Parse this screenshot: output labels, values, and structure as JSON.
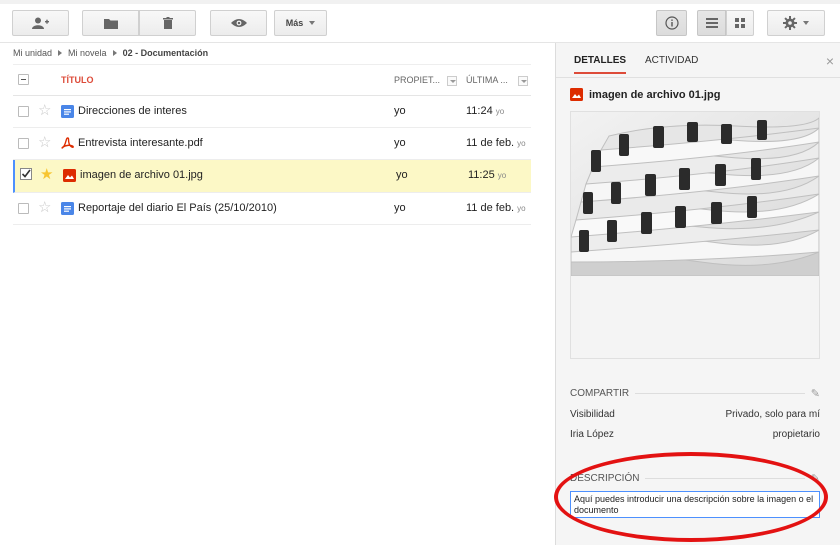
{
  "toolbar": {
    "more_label": "Más"
  },
  "breadcrumb": [
    "Mi unidad",
    "Mi novela",
    "02 - Documentación"
  ],
  "columns": {
    "title": "TÍTULO",
    "owner": "PROPIET...",
    "modified": "ÚLTIMA ..."
  },
  "files": [
    {
      "name": "Direcciones de interes",
      "icon": "doc-icon",
      "owner": "yo",
      "modified": "11:24",
      "who": "yo",
      "selected": false,
      "starred": false
    },
    {
      "name": "Entrevista interesante.pdf",
      "icon": "pdf-icon",
      "owner": "yo",
      "modified": "11 de feb.",
      "who": "yo",
      "selected": false,
      "starred": false
    },
    {
      "name": "imagen de archivo 01.jpg",
      "icon": "image-icon",
      "owner": "yo",
      "modified": "11:25",
      "who": "yo",
      "selected": true,
      "starred": true
    },
    {
      "name": "Reportaje del diario El País (25/10/2010)",
      "icon": "doc-icon",
      "owner": "yo",
      "modified": "11 de feb.",
      "who": "yo",
      "selected": false,
      "starred": false
    }
  ],
  "details": {
    "tab_details": "DETALLES",
    "tab_activity": "ACTIVIDAD",
    "file_name": "imagen de archivo 01.jpg",
    "share_label": "COMPARTIR",
    "visibility_label": "Visibilidad",
    "visibility_value": "Privado, solo para mí",
    "user_name": "Iria López",
    "user_role": "propietario",
    "description_label": "DESCRIPCIÓN",
    "description_text": "Aquí puedes introducir una descripción sobre la imagen o el documento"
  },
  "colors": {
    "accent_red": "#dd4b39",
    "select_yellow": "#fcf8c6",
    "blue": "#4d90fe",
    "annotation_red": "#e31212"
  }
}
